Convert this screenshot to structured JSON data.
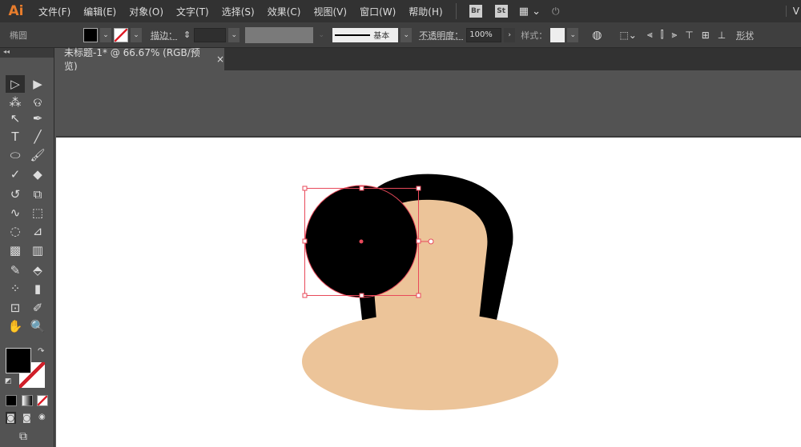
{
  "app": {
    "logo": "Ai"
  },
  "menu": [
    "文件(F)",
    "编辑(E)",
    "对象(O)",
    "文字(T)",
    "选择(S)",
    "效果(C)",
    "视图(V)",
    "窗口(W)",
    "帮助(H)"
  ],
  "menubar_badges": [
    "Br",
    "St"
  ],
  "menubar_right": "V",
  "control": {
    "object_type": "椭圆",
    "stroke_label": "描边：",
    "stroke_profile": "基本",
    "opacity_label": "不透明度：",
    "opacity_value": "100%",
    "style_label": "样式：",
    "shape_label": "形状"
  },
  "document_tab": {
    "title": "未标题-1* @ 66.67% (RGB/预览)",
    "close": "×"
  },
  "colors": {
    "fill": "#000000",
    "skin": "#ecc499",
    "selection": "#e8495a",
    "accent": "#e87d2c"
  },
  "tools": [
    "selection-tool",
    "direct-selection-tool",
    "magic-wand-tool",
    "lasso-tool",
    "curvature-tool",
    "pen-tool",
    "type-tool",
    "line-tool",
    "ellipse-tool",
    "paintbrush-tool",
    "shaper-tool",
    "eraser-tool",
    "rotate-tool",
    "scale-tool",
    "warp-tool",
    "free-transform-tool",
    "shape-builder-tool",
    "perspective-grid-tool",
    "mesh-tool",
    "gradient-tool",
    "eyedropper-tool",
    "blend-tool",
    "symbol-sprayer-tool",
    "column-graph-tool",
    "artboard-tool",
    "slice-tool",
    "hand-tool",
    "zoom-tool"
  ]
}
